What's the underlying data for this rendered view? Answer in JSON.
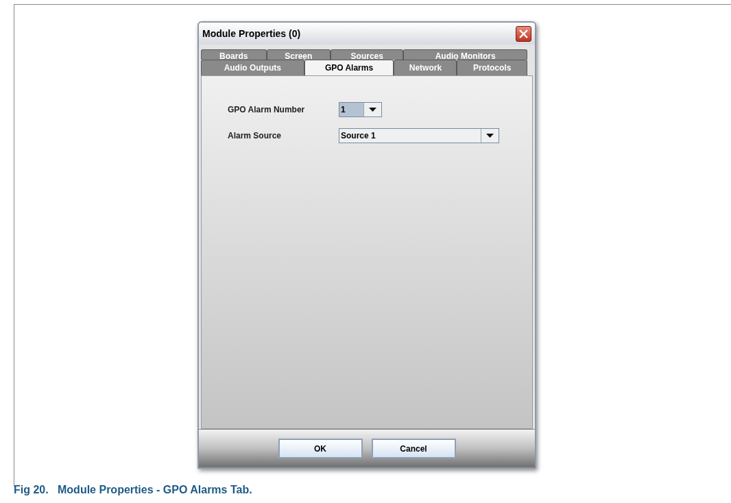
{
  "window": {
    "title": "Module Properties (0)"
  },
  "tab_rows": [
    [
      {
        "label": "Boards",
        "selected": false
      },
      {
        "label": "Screen",
        "selected": false
      },
      {
        "label": "Sources",
        "selected": false
      },
      {
        "label": "Audio Monitors",
        "selected": false
      }
    ],
    [
      {
        "label": "Audio Outputs",
        "selected": false
      },
      {
        "label": "GPO Alarms",
        "selected": true
      },
      {
        "label": "Network",
        "selected": false
      },
      {
        "label": "Protocols",
        "selected": false
      }
    ]
  ],
  "fields": [
    {
      "label": "GPO Alarm Number",
      "value": "1",
      "kind": "short"
    },
    {
      "label": "Alarm Source",
      "value": "Source 1",
      "kind": "wide"
    }
  ],
  "buttons": [
    "OK",
    "Cancel"
  ],
  "caption": "Fig 20.   Module Properties - GPO Alarms Tab."
}
